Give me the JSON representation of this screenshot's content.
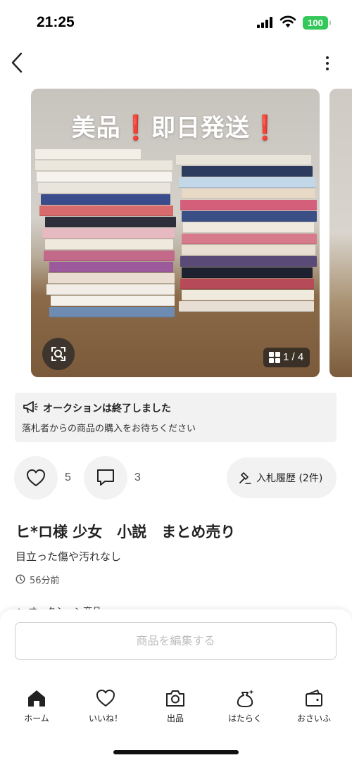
{
  "status_bar": {
    "time": "21:25",
    "battery": "100"
  },
  "gallery": {
    "caption_part1": "美品",
    "caption_mark": "❗",
    "caption_part2": "即日発送",
    "page_indicator": "1 / 4"
  },
  "notice": {
    "title": "オークションは終了しました",
    "body": "落札者からの商品の購入をお待ちください"
  },
  "actions": {
    "like_count": "5",
    "comment_count": "3",
    "bid_history_label": "入札履歴 (2件)"
  },
  "item": {
    "title": "ヒ*ロ様 少女　小説　まとめ売り",
    "subtitle": "目立った傷や汚れなし",
    "time_ago": "56分前",
    "section_label": "オークション商品"
  },
  "edit_button_label": "商品を編集する",
  "tab_bar": {
    "items": [
      {
        "label": "ホーム",
        "icon": "home-icon"
      },
      {
        "label": "いいね！",
        "icon": "heart-icon"
      },
      {
        "label": "出品",
        "icon": "camera-icon"
      },
      {
        "label": "はたらく",
        "icon": "money-bag-icon"
      },
      {
        "label": "おさいふ",
        "icon": "wallet-icon"
      }
    ]
  },
  "colors": {
    "battery": "#34c759",
    "caption_mark": "#e53935",
    "tab_active": "#222222",
    "button_disabled_text": "#bdbdbd"
  }
}
